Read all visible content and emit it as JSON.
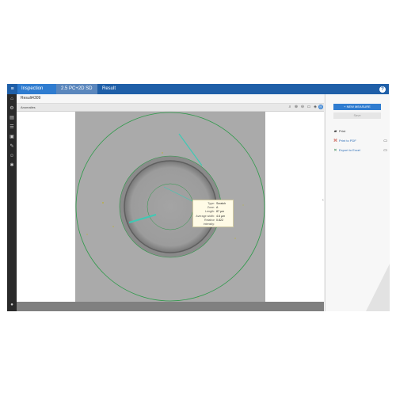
{
  "topbar": {
    "menu_icon": "hamburger-icon",
    "inspection_label": "Inspection",
    "pc_label": "2.5 PC+2D SD",
    "result_label": "Result",
    "help_icon": "help-icon",
    "help_glyph": "?"
  },
  "sidebar": {
    "icons": [
      "home-icon",
      "settings-icon",
      "book-icon",
      "list-icon",
      "image-icon",
      "tools-icon",
      "users-icon",
      "gear-icon"
    ],
    "bottom_icon": "user-icon"
  },
  "subbar": {
    "title": "Result4309"
  },
  "toolbar": {
    "label": "Anomalies",
    "tools": [
      "zoom-icon",
      "zoom-in-icon",
      "zoom-out-icon",
      "fit-icon",
      "layers-icon",
      "settings-icon",
      "target-icon"
    ]
  },
  "tooltip": {
    "rows": [
      {
        "key": "Type:",
        "value": "Scratch"
      },
      {
        "key": "Zone:",
        "value": "A"
      },
      {
        "key": "Length:",
        "value": "87 µm"
      },
      {
        "key": "Average width:",
        "value": "4.6 µm"
      },
      {
        "key": "Relative intensity:",
        "value": "0.822"
      }
    ]
  },
  "rightpanel": {
    "new_measure_label": "+ NEW MEASURE",
    "save_label": "Save",
    "print_label": "Print",
    "print_pdf_label": "Print to PDF",
    "export_excel_label": "Export to Excel"
  },
  "colors": {
    "accent": "#1f5fa8",
    "circle": "#2e9a4a",
    "scratch": "#3fc9b4"
  }
}
